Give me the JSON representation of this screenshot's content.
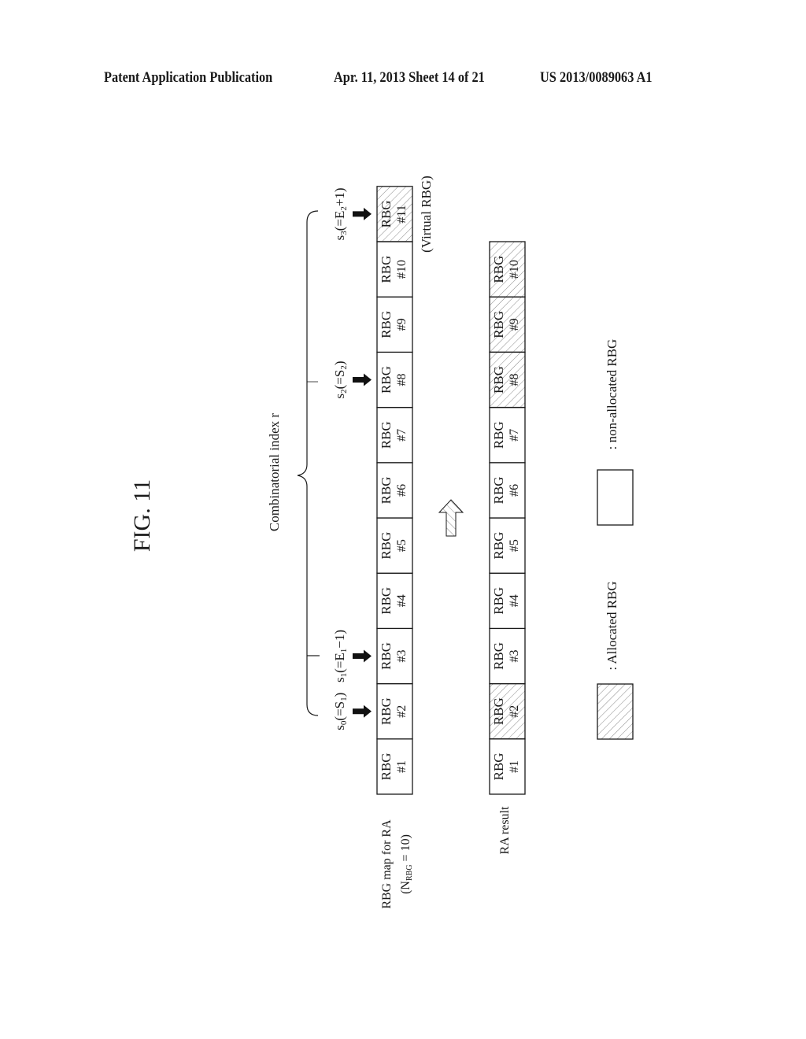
{
  "header": {
    "publication": "Patent Application Publication",
    "date_sheet": "Apr. 11, 2013  Sheet 14 of 21",
    "patent_number": "US 2013/0089063 A1"
  },
  "figure": {
    "title": "FIG. 11",
    "brace_label": "Combinatorial index r",
    "row1": {
      "label_line1": "RBG map for RA",
      "label_line2_prefix": "(N",
      "label_line2_sub": "RBG",
      "label_line2_suffix": " = 10)",
      "cell_title": "RBG",
      "cells": [
        {
          "num": "#1",
          "allocated": false
        },
        {
          "num": "#2",
          "allocated": false
        },
        {
          "num": "#3",
          "allocated": false
        },
        {
          "num": "#4",
          "allocated": false
        },
        {
          "num": "#5",
          "allocated": false
        },
        {
          "num": "#6",
          "allocated": false
        },
        {
          "num": "#7",
          "allocated": false
        },
        {
          "num": "#8",
          "allocated": false
        },
        {
          "num": "#9",
          "allocated": false
        },
        {
          "num": "#10",
          "allocated": false
        },
        {
          "num": "#11",
          "allocated": true
        }
      ],
      "virtual_label": "(Virtual RBG)"
    },
    "pointers": [
      {
        "cell_index": 1,
        "s": "s",
        "s_sub": "0",
        "eq": "(=S",
        "eq_sub": "1",
        "tail": ")"
      },
      {
        "cell_index": 2,
        "s": "s",
        "s_sub": "1",
        "eq": "(=E",
        "eq_sub": "1",
        "tail": "−1)"
      },
      {
        "cell_index": 7,
        "s": "s",
        "s_sub": "2",
        "eq": "(=S",
        "eq_sub": "2",
        "tail": ")"
      },
      {
        "cell_index": 10,
        "s": "s",
        "s_sub": "3",
        "eq": "(=E",
        "eq_sub": "2",
        "tail": "+1)"
      }
    ],
    "row2": {
      "label": "RA result",
      "cell_title": "RBG",
      "cells": [
        {
          "num": "#1",
          "allocated": false
        },
        {
          "num": "#2",
          "allocated": true
        },
        {
          "num": "#3",
          "allocated": false
        },
        {
          "num": "#4",
          "allocated": false
        },
        {
          "num": "#5",
          "allocated": false
        },
        {
          "num": "#6",
          "allocated": false
        },
        {
          "num": "#7",
          "allocated": false
        },
        {
          "num": "#8",
          "allocated": true
        },
        {
          "num": "#9",
          "allocated": true
        },
        {
          "num": "#10",
          "allocated": true
        }
      ]
    },
    "legend": {
      "allocated": ": Allocated RBG",
      "non_allocated": ": non-allocated RBG"
    },
    "colors": {
      "line": "#1a1a1a",
      "hatch": "#8a8a8a"
    }
  }
}
